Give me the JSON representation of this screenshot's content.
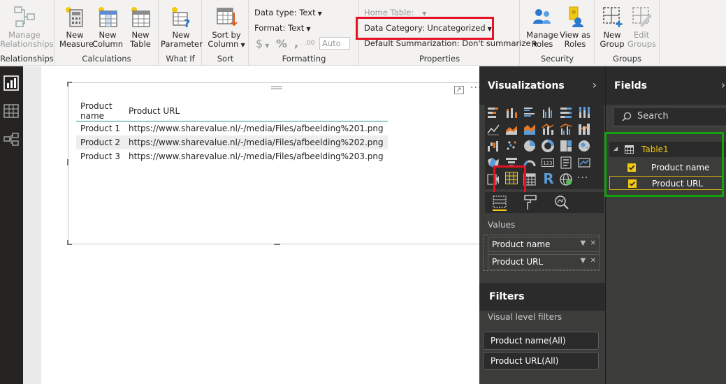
{
  "ribbon": {
    "relationships": {
      "manage_label": "Manage Relationships",
      "group": "Relationships"
    },
    "calculations": {
      "new_measure": "New Measure",
      "new_column": "New Column",
      "new_table": "New Table",
      "group": "Calculations"
    },
    "whatif": {
      "new_parameter": "New Parameter",
      "group": "What If"
    },
    "sort": {
      "sort_by_column": "Sort by Column",
      "group": "Sort"
    },
    "formatting": {
      "data_type": "Data type: Text",
      "format": "Format: Text",
      "currency": "$",
      "percent": "%",
      "comma": ",",
      "decimals": ".00",
      "auto": "Auto",
      "group": "Formatting"
    },
    "properties": {
      "home_table": "Home Table:",
      "data_category": "Data Category: Uncategorized",
      "default_summarization": "Default Summarization: Don't summarize",
      "group": "Properties"
    },
    "security": {
      "manage_roles": "Manage Roles",
      "view_as_roles": "View as Roles",
      "group": "Security"
    },
    "groups": {
      "new_group": "New Group",
      "edit_groups": "Edit Groups",
      "group": "Groups"
    }
  },
  "visual_table": {
    "columns": [
      "Product name",
      "Product URL"
    ],
    "rows": [
      [
        "Product 1",
        "https://www.sharevalue.nl/-/media/Files/afbeelding%201.png"
      ],
      [
        "Product 2",
        "https://www.sharevalue.nl/-/media/Files/afbeelding%202.png"
      ],
      [
        "Product 3",
        "https://www.sharevalue.nl/-/media/Files/afbeelding%203.png"
      ]
    ]
  },
  "visualizations": {
    "title": "Visualizations",
    "values_label": "Values",
    "wells": [
      "Product name",
      "Product URL"
    ],
    "card_value": "123",
    "r_label": "R",
    "more": "···"
  },
  "filters": {
    "title": "Filters",
    "visual_level": "Visual level filters",
    "items": [
      "Product name(All)",
      "Product URL(All)"
    ]
  },
  "fields": {
    "title": "Fields",
    "search_placeholder": "Search",
    "table_name": "Table1",
    "items": [
      "Product name",
      "Product URL"
    ]
  },
  "colors": {
    "accent_yellow": "#f2c811",
    "highlight_red": "#e81123",
    "highlight_green": "#13a10e",
    "table_header_rule": "#2e8b8b"
  }
}
